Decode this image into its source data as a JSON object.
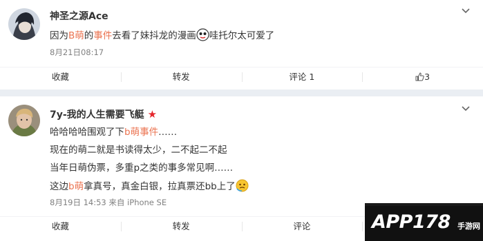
{
  "post1": {
    "username": "神圣之源Ace",
    "text_part1": "因为",
    "text_highlight1": "B萌",
    "text_part2": "的",
    "text_highlight2": "事件",
    "text_part3": "去看了妹抖龙的漫画",
    "text_part4": "哇托尔太可爱了",
    "timestamp": "8月21日08:17",
    "actions": {
      "save": "收藏",
      "repost": "转发",
      "comment": "评论 1",
      "like_count": "3"
    }
  },
  "post2": {
    "username": "7y-我的人生需要飞艇",
    "line1_part1": "哈哈哈哈围观了下",
    "line1_highlight": "b萌事件",
    "line1_part2": "……",
    "line2": "现在的萌二就是书读得太少，二不起二不起",
    "line3": "当年日萌伪票，多重p之类的事多常见啊……",
    "line4_part1": "这边",
    "line4_highlight": "b萌",
    "line4_part2": "拿真号，真金白银，拉真票还bb上了",
    "timestamp": "8月19日 14:53",
    "source": "来自 iPhone SE",
    "actions": {
      "save": "收藏",
      "repost": "转发",
      "comment": "评论"
    }
  },
  "watermark": {
    "text": "APP178",
    "small": "手游网"
  },
  "colors": {
    "highlight": "#eb7350",
    "meta": "#808080",
    "background": "#eaeef3"
  }
}
